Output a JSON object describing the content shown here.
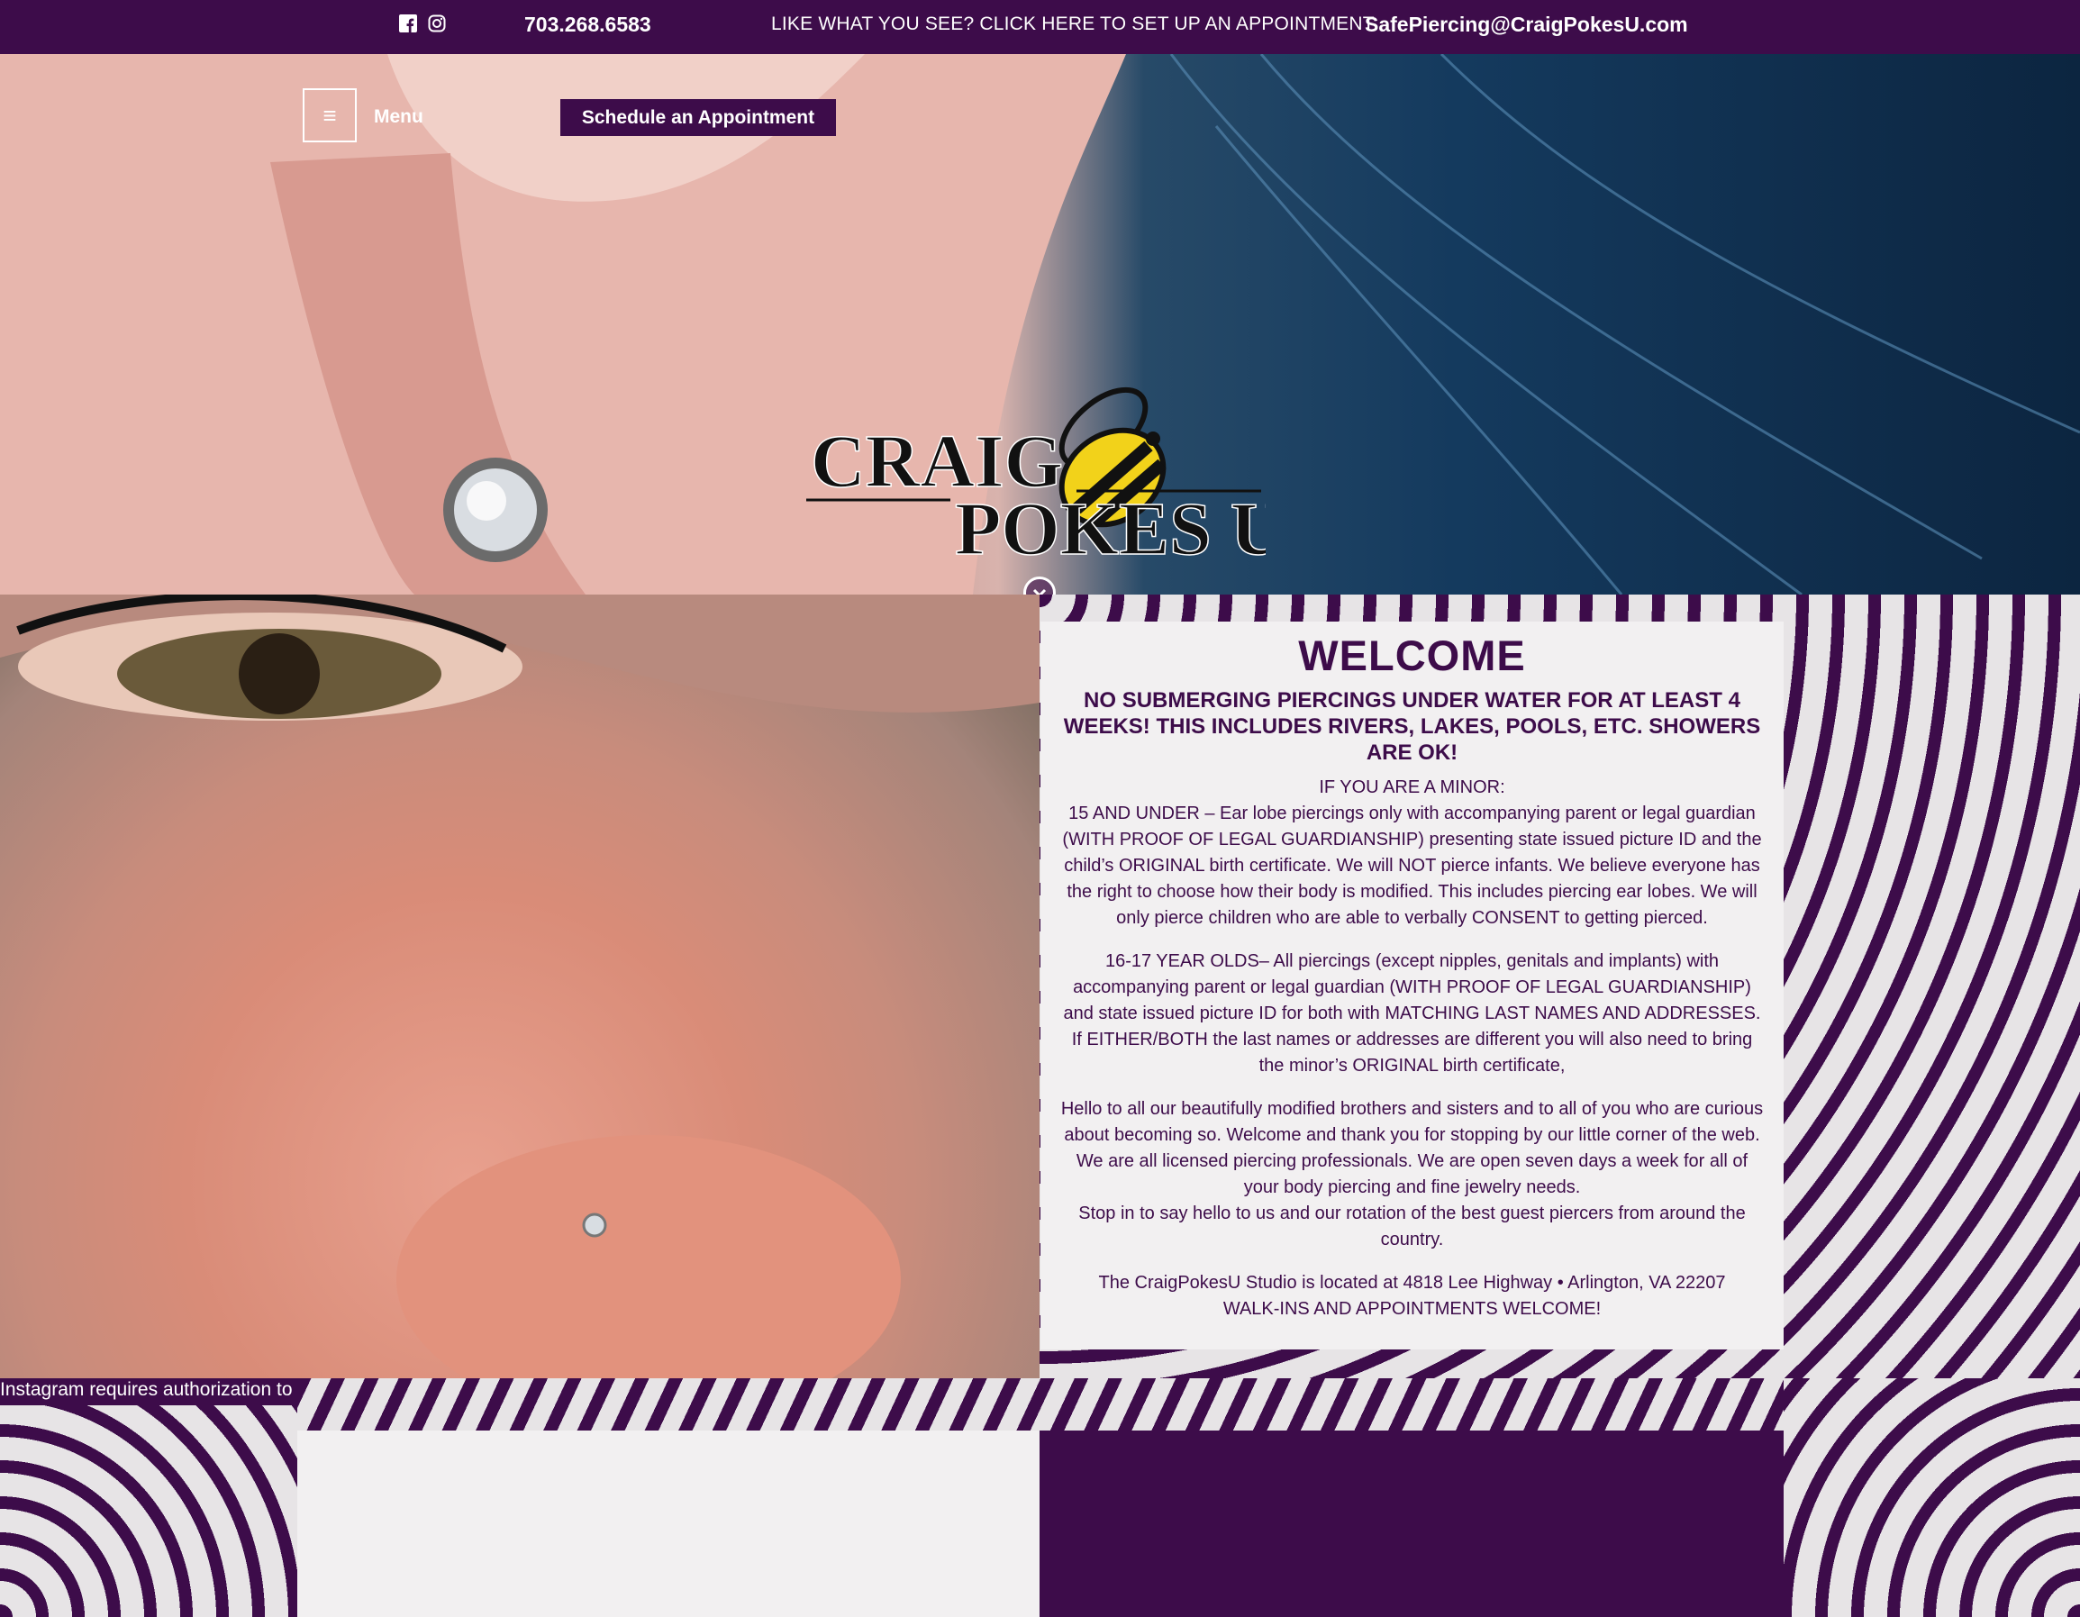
{
  "topbar": {
    "phone": "703.268.6583",
    "cta": "LIKE WHAT YOU SEE? CLICK HERE TO SET UP AN APPOINTMENT",
    "email": "SafePiercing@CraigPokesU.com",
    "icons": [
      "facebook-icon",
      "instagram-icon"
    ]
  },
  "header": {
    "menu_label": "Menu",
    "schedule_label": "Schedule an Appointment"
  },
  "logo": {
    "line1": "CRAIG",
    "line2": "POKES U"
  },
  "welcome": {
    "title": "WELCOME",
    "notice": "NO SUBMERGING PIERCINGS UNDER WATER FOR AT LEAST 4 WEEKS! THIS INCLUDES RIVERS, LAKES, POOLS, ETC. SHOWERS ARE OK!",
    "minor_heading": "IF YOU ARE A MINOR:",
    "minor_15": "15 AND UNDER – Ear lobe piercings only with accompanying parent or legal guardian (WITH PROOF OF LEGAL GUARDIANSHIP) presenting state issued picture ID and the child’s ORIGINAL birth certificate. We will NOT pierce infants. We believe everyone has the right to choose how their body is modified. This includes piercing ear lobes. We will only pierce children who are able to verbally CONSENT to getting pierced.",
    "minor_16": "16-17 YEAR OLDS– All piercings (except nipples, genitals and implants) with accompanying parent or legal guardian (WITH PROOF OF LEGAL GUARDIANSHIP) and state issued picture ID for both with MATCHING LAST NAMES AND ADDRESSES. If EITHER/BOTH the last names or addresses are different you will also need to bring the minor’s ORIGINAL birth certificate,",
    "hello": "Hello to all our beautifully modified brothers and sisters and to all of you who are curious about becoming so. Welcome and thank you for stopping by our little corner of the web.  We are all licensed piercing professionals. We are open seven days a week for all of your body piercing and fine jewelry needs.",
    "stop_in": "Stop in to say hello to us and our rotation of the best guest piercers from around the country.",
    "location": "The CraigPokesU Studio is located at 4818 Lee Highway • Arlington, VA 22207",
    "walkins": "WALK-INS AND APPOINTMENTS WELCOME!"
  },
  "instagram_notice": "Instagram requires authorization to view a user profile. Use autorized account in widget settings",
  "colors": {
    "brand_purple": "#3d0c4a",
    "card_bg": "#f2f0f1",
    "bee_yellow": "#f2d21a"
  }
}
